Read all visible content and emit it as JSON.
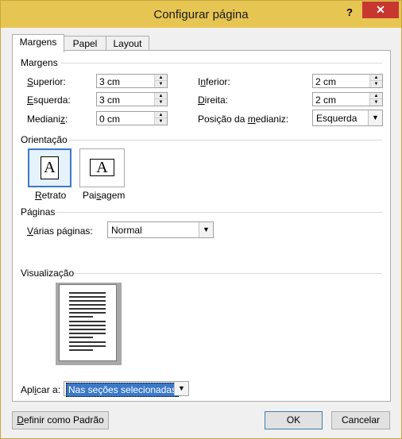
{
  "window": {
    "title": "Configurar página",
    "help_label": "?",
    "close_label": "✕"
  },
  "tabs": [
    {
      "label": "Margens",
      "active": true
    },
    {
      "label": "Papel",
      "active": false
    },
    {
      "label": "Layout",
      "active": false
    }
  ],
  "margins": {
    "group_label": "Margens",
    "top_label": "Superior:",
    "top_value": "3 cm",
    "bottom_label": "Inferior:",
    "bottom_value": "2 cm",
    "left_label": "Esquerda:",
    "left_value": "3 cm",
    "right_label": "Direita:",
    "right_value": "2 cm",
    "gutter_label": "Medianiz:",
    "gutter_value": "0 cm",
    "gutter_pos_label": "Posição da medianiz:",
    "gutter_pos_value": "Esquerda"
  },
  "orientation": {
    "group_label": "Orientação",
    "portrait_label": "Retrato",
    "portrait_icon_text": "A",
    "landscape_label": "Paisagem",
    "landscape_icon_text": "A",
    "selected": "portrait"
  },
  "pages": {
    "group_label": "Páginas",
    "multiple_label": "Várias páginas:",
    "multiple_value": "Normal"
  },
  "preview": {
    "group_label": "Visualização",
    "apply_label": "Aplicar a:",
    "apply_value": "Nas seções selecionadas"
  },
  "buttons": {
    "default_label": "Definir como Padrão",
    "ok_label": "OK",
    "cancel_label": "Cancelar"
  },
  "colors": {
    "titlebar": "#e7c553",
    "close": "#c7372f",
    "selection": "#3b79c7"
  }
}
